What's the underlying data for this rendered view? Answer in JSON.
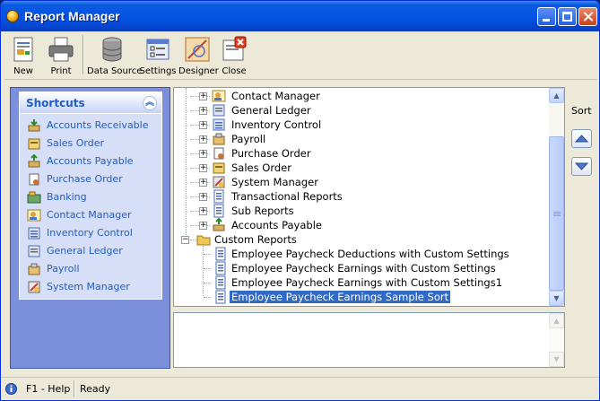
{
  "window": {
    "title": "Report Manager"
  },
  "toolbar": {
    "items": [
      {
        "label": "New",
        "icon": "new-report-icon"
      },
      {
        "label": "Print",
        "icon": "printer-icon"
      },
      {
        "label": "Data Source",
        "icon": "database-icon"
      },
      {
        "label": "Settings",
        "icon": "settings-icon"
      },
      {
        "label": "Designer",
        "icon": "designer-icon"
      },
      {
        "label": "Close",
        "icon": "close-report-icon"
      }
    ]
  },
  "shortcuts": {
    "title": "Shortcuts",
    "items": [
      {
        "label": "Accounts Receivable",
        "icon": "accounts-receivable-icon"
      },
      {
        "label": "Sales Order",
        "icon": "sales-order-icon"
      },
      {
        "label": "Accounts Payable",
        "icon": "accounts-payable-icon"
      },
      {
        "label": "Purchase Order",
        "icon": "purchase-order-icon"
      },
      {
        "label": "Banking",
        "icon": "banking-icon"
      },
      {
        "label": "Contact Manager",
        "icon": "contact-manager-icon"
      },
      {
        "label": "Inventory Control",
        "icon": "inventory-control-icon"
      },
      {
        "label": "General Ledger",
        "icon": "general-ledger-icon"
      },
      {
        "label": "Payroll",
        "icon": "payroll-icon"
      },
      {
        "label": "System Manager",
        "icon": "system-manager-icon"
      }
    ]
  },
  "tree": {
    "nodes": [
      {
        "label": "Contact Manager",
        "expander": "+"
      },
      {
        "label": "General Ledger",
        "expander": "+"
      },
      {
        "label": "Inventory Control",
        "expander": "+"
      },
      {
        "label": "Payroll",
        "expander": "+"
      },
      {
        "label": "Purchase Order",
        "expander": "+"
      },
      {
        "label": "Sales Order",
        "expander": "+"
      },
      {
        "label": "System Manager",
        "expander": "+"
      },
      {
        "label": "Transactional Reports",
        "expander": "+"
      },
      {
        "label": "Sub Reports",
        "expander": "+"
      },
      {
        "label": "Accounts Payable",
        "expander": "+"
      },
      {
        "label": "Custom Reports",
        "expander": "−"
      },
      {
        "label": "Employee Paycheck Deductions with Custom Settings"
      },
      {
        "label": "Employee Paycheck Earnings with Custom Settings"
      },
      {
        "label": "Employee Paycheck Earnings with Custom Settings1"
      },
      {
        "label": "Employee Paycheck Earnings Sample Sort",
        "selected": true
      }
    ]
  },
  "sort": {
    "label": "Sort"
  },
  "status": {
    "help": "F1 - Help",
    "text": "Ready"
  },
  "colors": {
    "selection": "#316ac5",
    "link": "#215dc6",
    "titlebar": "#0553e4"
  }
}
